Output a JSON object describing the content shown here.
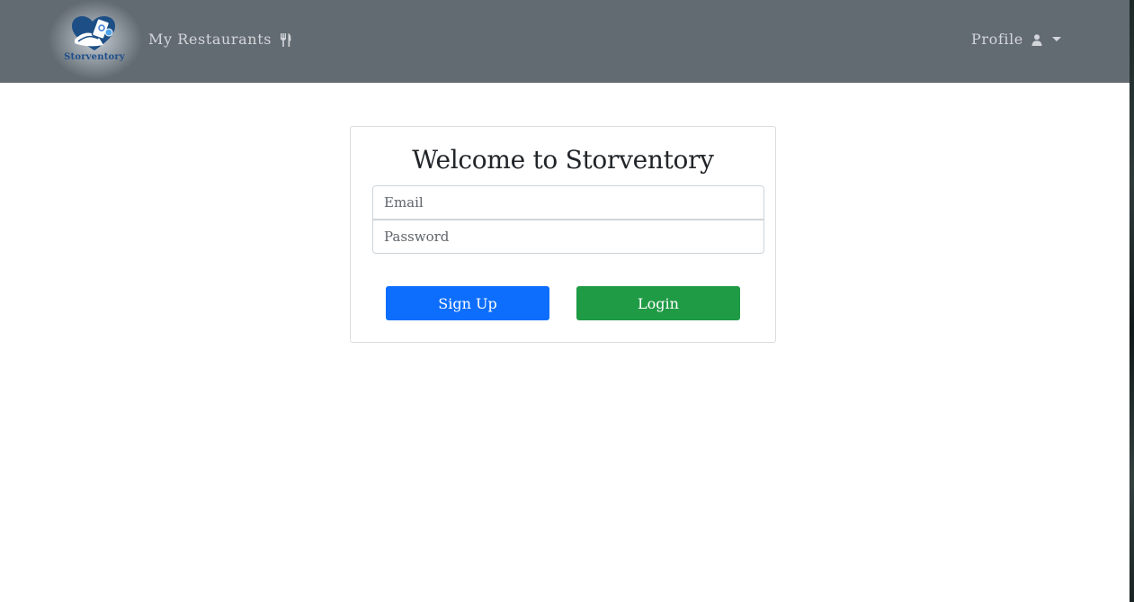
{
  "brand": {
    "name": "Storventory",
    "logo_icon": "storventory-logo"
  },
  "nav": {
    "restaurants_label": "My Restaurants",
    "restaurants_icon": "utensils-icon",
    "profile_label": "Profile",
    "profile_icon": "user-icon"
  },
  "login": {
    "title": "Welcome to Storventory",
    "email_placeholder": "Email",
    "email_value": "",
    "password_placeholder": "Password",
    "password_value": "",
    "signup_label": "Sign Up",
    "login_label": "Login"
  },
  "colors": {
    "navbar": "#636b72",
    "signup_button": "#0d6efd",
    "login_button": "#1f9a45"
  }
}
